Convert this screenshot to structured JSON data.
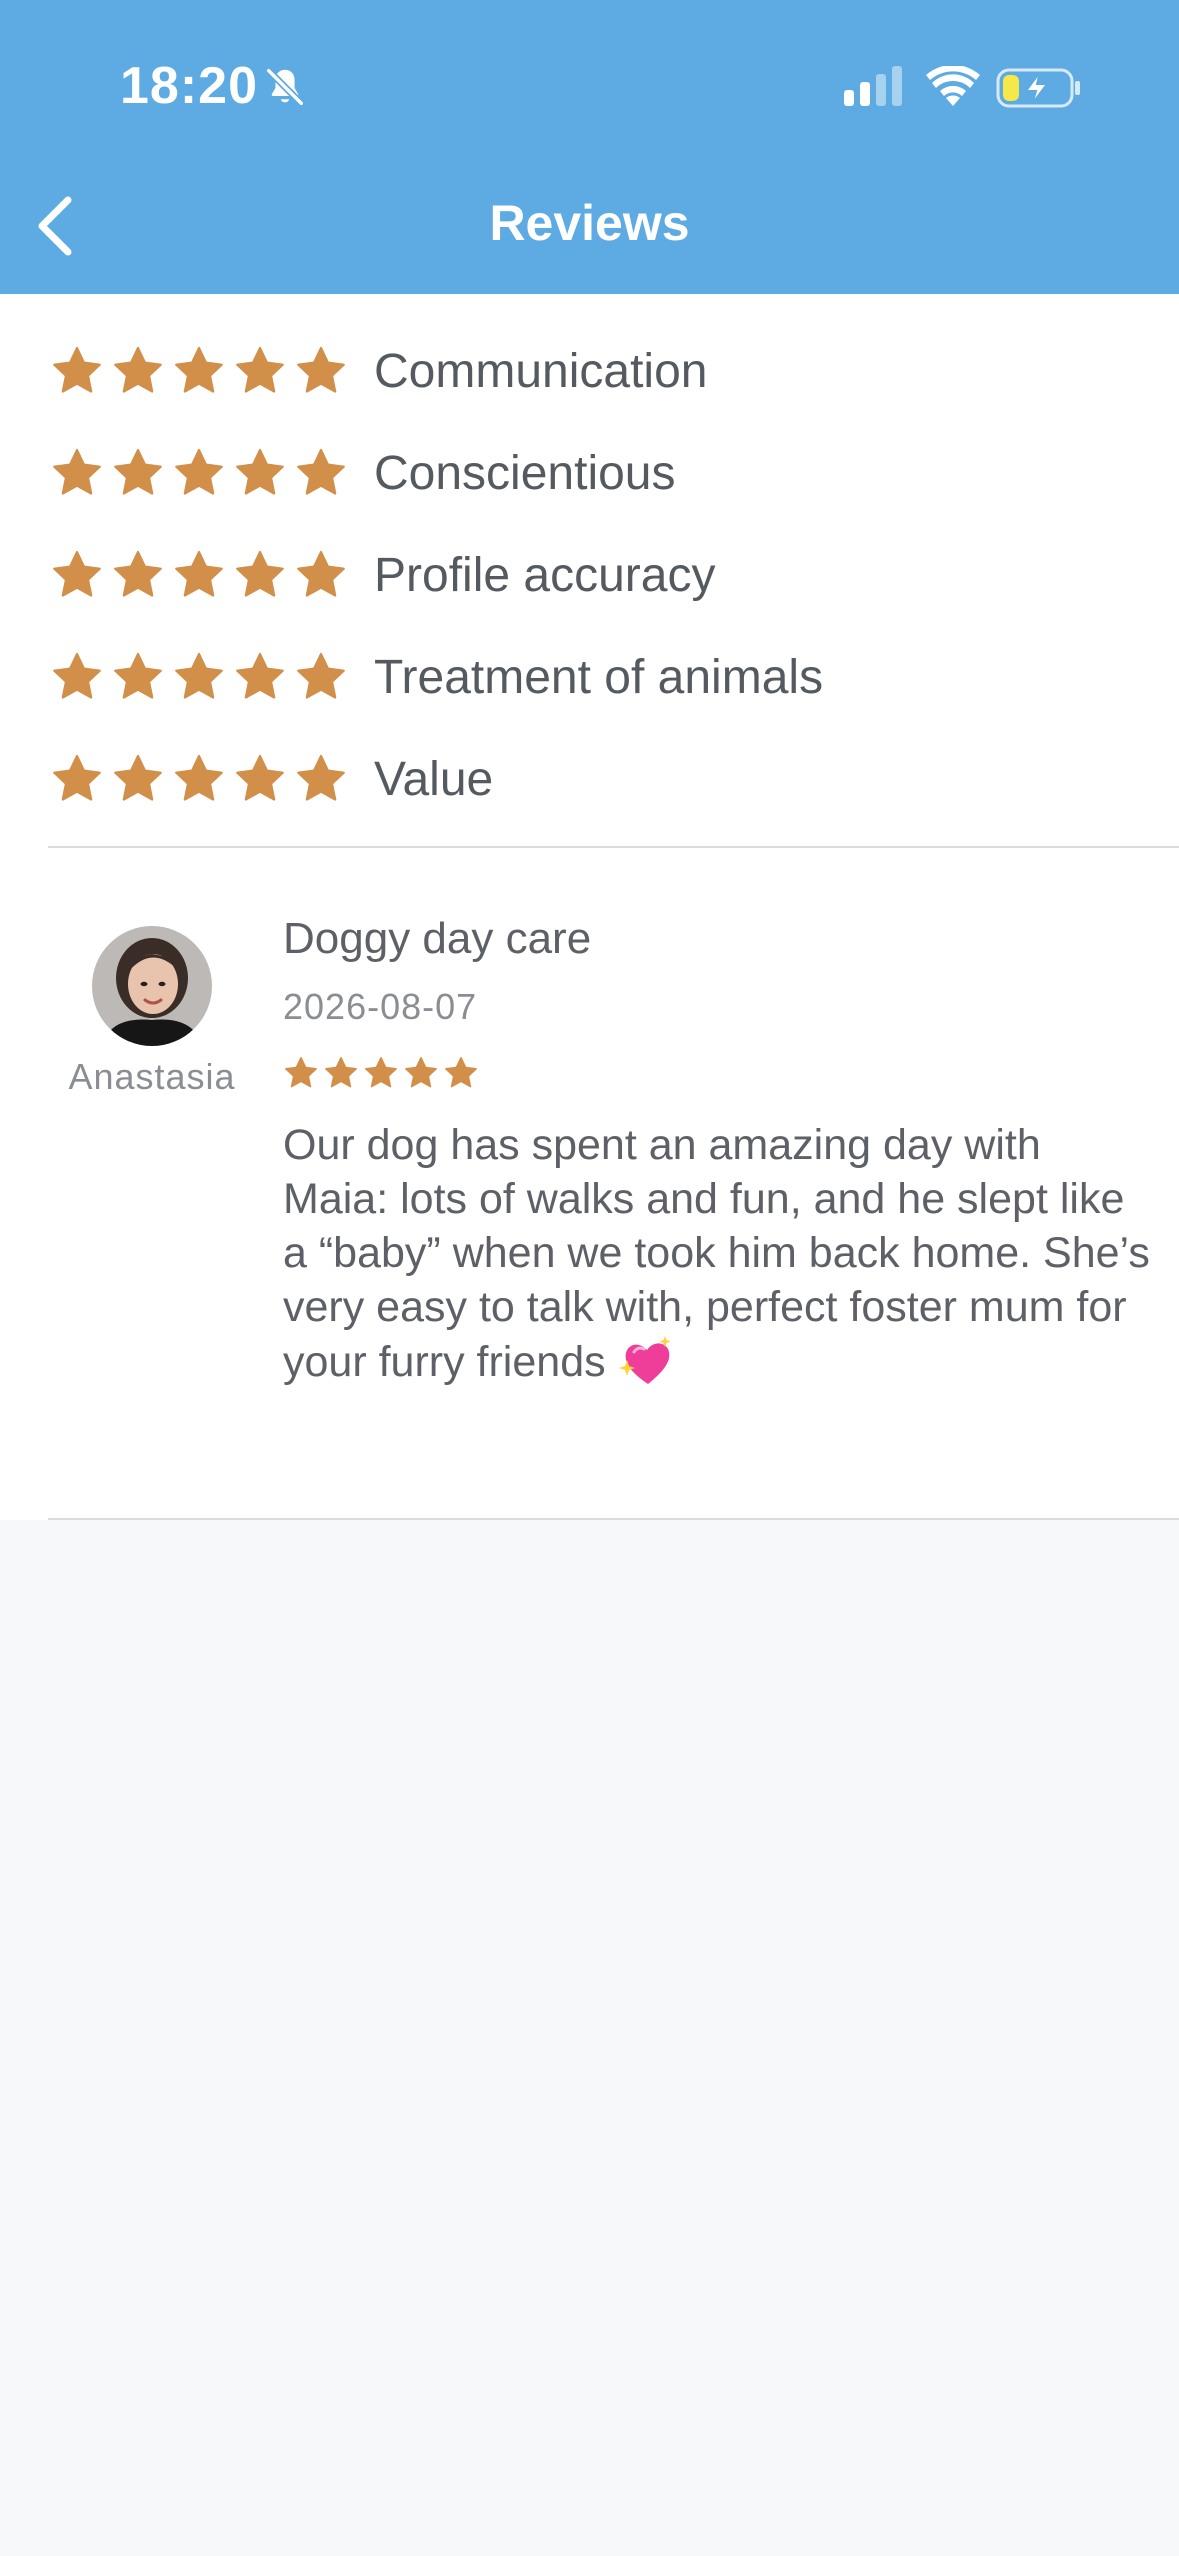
{
  "status_bar": {
    "time": "18:20"
  },
  "header": {
    "title": "Reviews",
    "background_color": "#5dabe2"
  },
  "ratings": [
    {
      "label": "Communication",
      "stars": 5
    },
    {
      "label": "Conscientious",
      "stars": 5
    },
    {
      "label": "Profile accuracy",
      "stars": 5
    },
    {
      "label": "Treatment of animals",
      "stars": 5
    },
    {
      "label": "Value",
      "stars": 5
    }
  ],
  "star_color": "#d18f4a",
  "review": {
    "reviewer": "Anastasia",
    "title": "Doggy day care",
    "date": "2026-08-07",
    "stars": 5,
    "text": "Our dog has spent an amazing day with Maia: lots of walks and fun, and he slept like a “baby” when we took him back home. She’s very easy to talk with, perfect foster mum for your furry friends",
    "trailing_icon": "sparkling-heart-icon"
  }
}
